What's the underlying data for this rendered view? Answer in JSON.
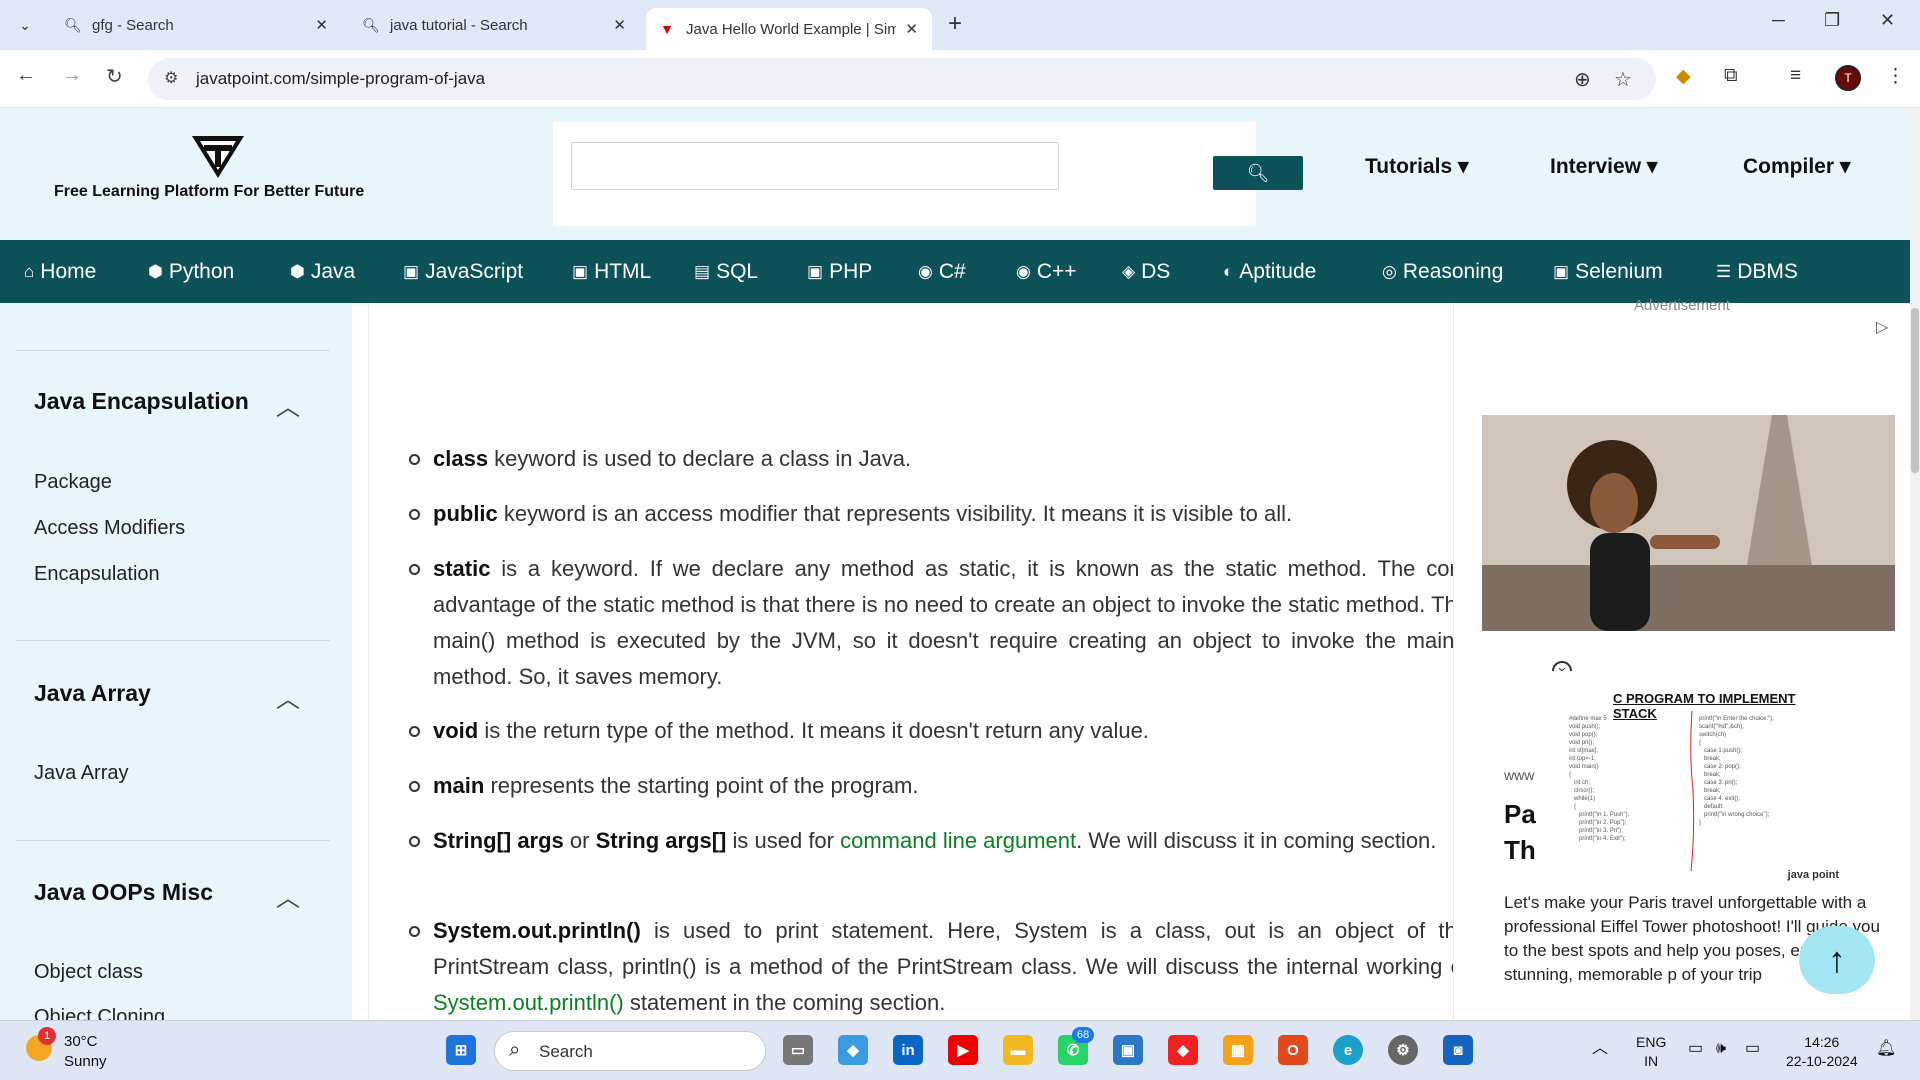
{
  "browser": {
    "tabs": [
      {
        "title": "gfg - Search",
        "icon": "search-icon"
      },
      {
        "title": "java tutorial - Search",
        "icon": "search-icon"
      },
      {
        "title": "Java Hello World Example | Sim",
        "icon": "javatpoint-icon"
      }
    ],
    "url": "javatpoint.com/simple-program-of-java"
  },
  "header": {
    "tagline": "Free Learning Platform For Better Future",
    "menus": [
      "Tutorials",
      "Interview",
      "Compiler"
    ]
  },
  "nav": [
    "Home",
    "Python",
    "Java",
    "JavaScript",
    "HTML",
    "SQL",
    "PHP",
    "C#",
    "C++",
    "DS",
    "Aptitude",
    "Reasoning",
    "Selenium",
    "DBMS"
  ],
  "sidebar": {
    "sections": [
      {
        "title": "Java Encapsulation",
        "links": [
          "Package",
          "Access Modifiers",
          "Encapsulation"
        ]
      },
      {
        "title": "Java Array",
        "links": [
          "Java Array"
        ]
      },
      {
        "title": "Java OOPs Misc",
        "links": [
          "Object class",
          "Object Cloning"
        ]
      }
    ]
  },
  "content": {
    "bullets": [
      {
        "kw": "class",
        "text": " keyword is used to declare a class in Java."
      },
      {
        "kw": "public",
        "text": " keyword is an access modifier that represents visibility. It means it is visible to all."
      },
      {
        "kw": "static",
        "text": " is a keyword. If we declare any method as static, it is known as the static method. The core advantage of the static method is that there is no need to create an object to invoke the static method. The main() method is executed by the JVM, so it doesn't require creating an object to invoke the main() method. So, it saves memory."
      },
      {
        "kw": "void",
        "text": " is the return type of the method. It means it doesn't return any value."
      },
      {
        "kw": "main",
        "text": " represents the starting point of the program."
      },
      {
        "kw": "String[] args",
        "mid": " or ",
        "kw2": "String args[]",
        "text": " is used for ",
        "link": "command line argument",
        "tail": ". We will discuss it in coming section."
      },
      {
        "kw": "System.out.println()",
        "text": " is used to print statement. Here, System is a class, out is an object of the PrintStream class, println() is a method of the PrintStream class. We will discuss the internal working of ",
        "link": "System.out.println()",
        "tail": " statement in the coming section."
      }
    ]
  },
  "ad": {
    "label": "Advertisement",
    "image_title": "C PROGRAM TO IMPLEMENT STACK",
    "www": "www",
    "headline1": "Pa",
    "headline2": "Th",
    "body": "Let's make your Paris travel unforgettable with a professional Eiffel Tower photoshoot! I'll guide you to the best spots and help you poses, ensuring stunning, memorable p of your trip",
    "watermark": "java point"
  },
  "taskbar": {
    "weather_temp": "30°C",
    "weather_desc": "Sunny",
    "weather_badge": "1",
    "search_label": "Search",
    "whatsapp_badge": "68",
    "lang": "ENG",
    "region": "IN",
    "time": "14:26",
    "date": "22-10-2024"
  }
}
